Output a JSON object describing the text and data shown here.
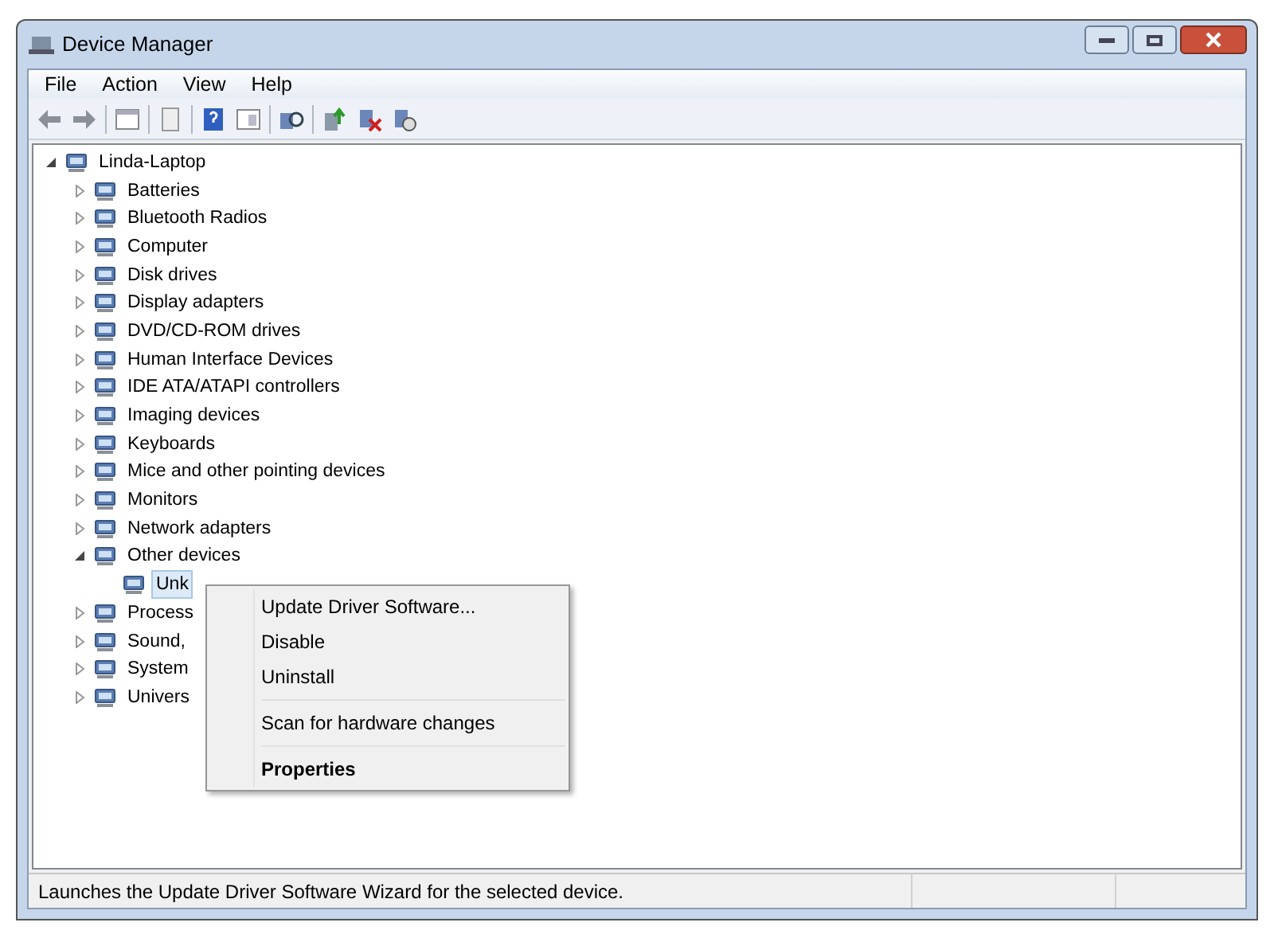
{
  "window": {
    "title": "Device Manager"
  },
  "menu": [
    "File",
    "Action",
    "View",
    "Help"
  ],
  "tree": {
    "label": "Linda-Laptop",
    "expanded": true,
    "children": [
      {
        "label": "Batteries",
        "expanded": false
      },
      {
        "label": "Bluetooth Radios",
        "expanded": false
      },
      {
        "label": "Computer",
        "expanded": false
      },
      {
        "label": "Disk drives",
        "expanded": false
      },
      {
        "label": "Display adapters",
        "expanded": false
      },
      {
        "label": "DVD/CD-ROM drives",
        "expanded": false
      },
      {
        "label": "Human Interface Devices",
        "expanded": false
      },
      {
        "label": "IDE ATA/ATAPI controllers",
        "expanded": false
      },
      {
        "label": "Imaging devices",
        "expanded": false
      },
      {
        "label": "Keyboards",
        "expanded": false
      },
      {
        "label": "Mice and other pointing devices",
        "expanded": false
      },
      {
        "label": "Monitors",
        "expanded": false
      },
      {
        "label": "Network adapters",
        "expanded": false
      },
      {
        "label": "Other devices",
        "expanded": true,
        "children": [
          {
            "label": "Unk",
            "selected": true
          }
        ]
      },
      {
        "label": "Process",
        "expanded": false
      },
      {
        "label": "Sound,",
        "expanded": false
      },
      {
        "label": "System",
        "expanded": false
      },
      {
        "label": "Univers",
        "expanded": false
      }
    ]
  },
  "context_menu": [
    {
      "kind": "item",
      "label": "Update Driver Software...",
      "default": false
    },
    {
      "kind": "item",
      "label": "Disable",
      "default": false
    },
    {
      "kind": "item",
      "label": "Uninstall",
      "default": false
    },
    {
      "kind": "separator"
    },
    {
      "kind": "item",
      "label": "Scan for hardware changes",
      "default": false
    },
    {
      "kind": "separator"
    },
    {
      "kind": "item",
      "label": "Properties",
      "default": true
    }
  ],
  "status_bar": "Launches the Update Driver Software Wizard for the selected device."
}
